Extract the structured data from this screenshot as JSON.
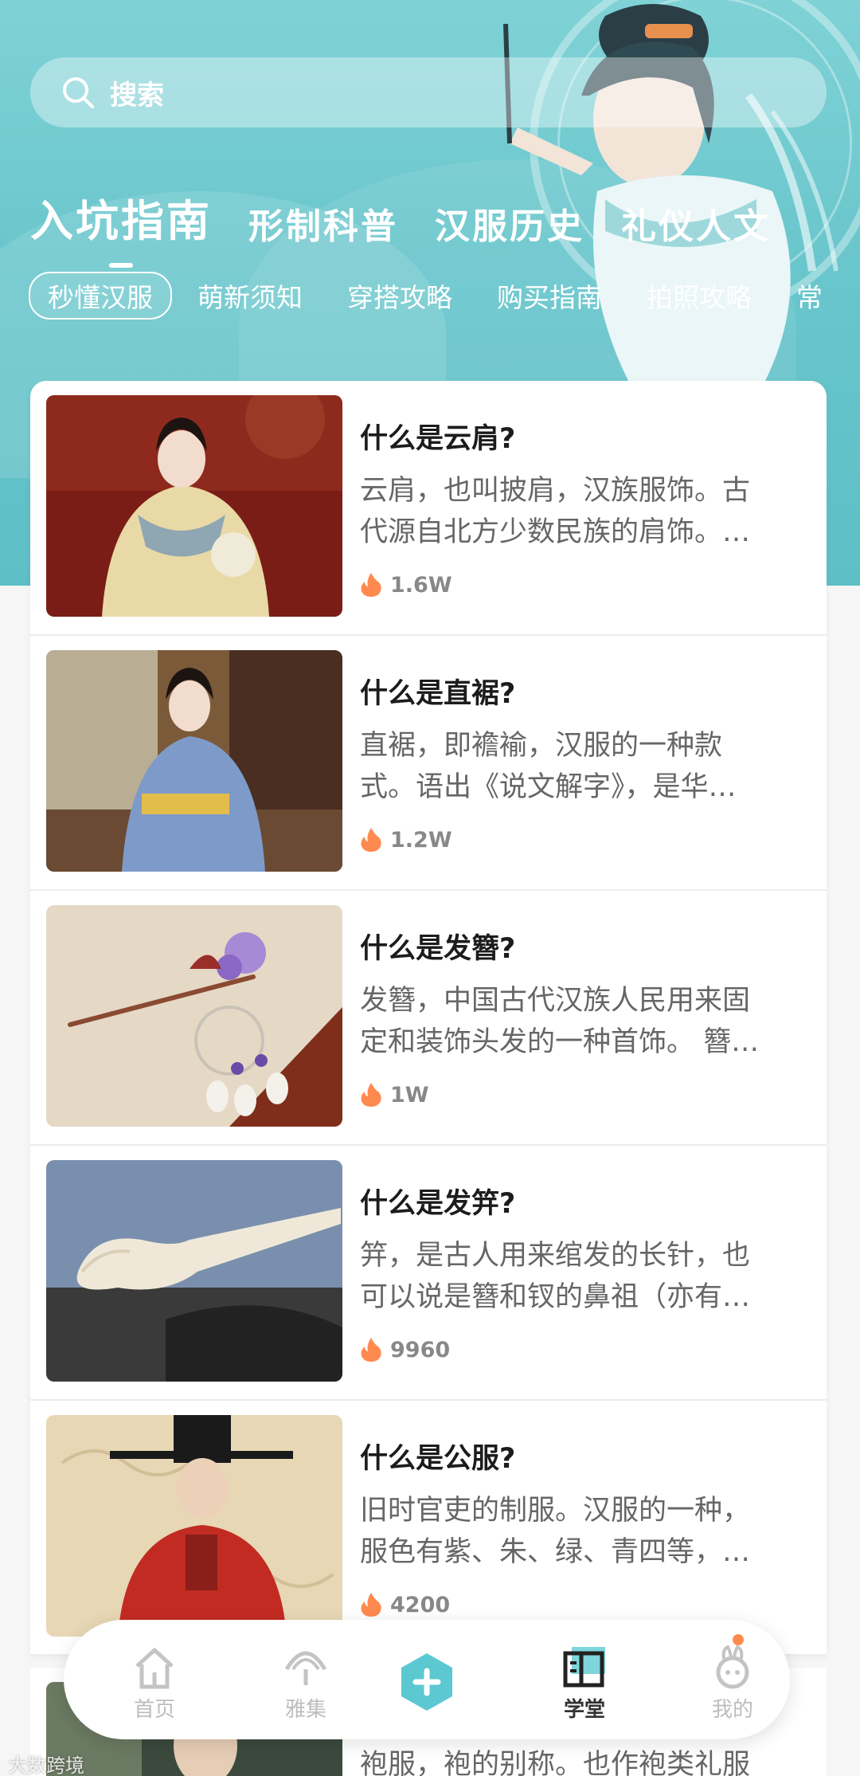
{
  "search": {
    "placeholder": "搜索"
  },
  "tabs": [
    {
      "label": "入坑指南",
      "active": true
    },
    {
      "label": "形制科普",
      "active": false
    },
    {
      "label": "汉服历史",
      "active": false
    },
    {
      "label": "礼仪人文",
      "active": false
    }
  ],
  "chips": [
    {
      "label": "秒懂汉服",
      "active": true
    },
    {
      "label": "萌新须知",
      "active": false
    },
    {
      "label": "穿搭攻略",
      "active": false
    },
    {
      "label": "购买指南",
      "active": false
    },
    {
      "label": "拍照攻略",
      "active": false
    },
    {
      "label": "常",
      "active": false
    }
  ],
  "articles": [
    {
      "title": "什么是云肩?",
      "desc_line1": "云肩，也叫披肩，汉族服饰。古",
      "desc_line2": "代源自北方少数民族的肩饰。…",
      "views": "1.6W"
    },
    {
      "title": "什么是直裾?",
      "desc_line1": "直裾，即襜褕，汉服的一种款",
      "desc_line2": "式。语出《说文解字》，是华…",
      "views": "1.2W"
    },
    {
      "title": "什么是发簪?",
      "desc_line1": "发簪，中国古代汉族人民用来固",
      "desc_line2": "定和装饰头发的一种首饰。 簪…",
      "views": "1W"
    },
    {
      "title": "什么是发笄?",
      "desc_line1": "笄，是古人用来绾发的长针，也",
      "desc_line2": "可以说是簪和钗的鼻祖（亦有…",
      "views": "9960"
    },
    {
      "title": "什么是公服?",
      "desc_line1": "旧时官吏的制服。汉服的一种，",
      "desc_line2": "服色有紫、朱、绿、青四等，…",
      "views": "4200"
    }
  ],
  "partial_article": {
    "desc_line1": "袍服，袍的别称。也作袍类礼服"
  },
  "nav": {
    "home": "首页",
    "collection": "雅集",
    "school": "学堂",
    "mine": "我的",
    "active": "school"
  },
  "watermark": "大数跨境",
  "colors": {
    "header_teal": "#69c6cc",
    "accent_orange": "#ff8a50",
    "plus_button": "#5cc8d2"
  }
}
